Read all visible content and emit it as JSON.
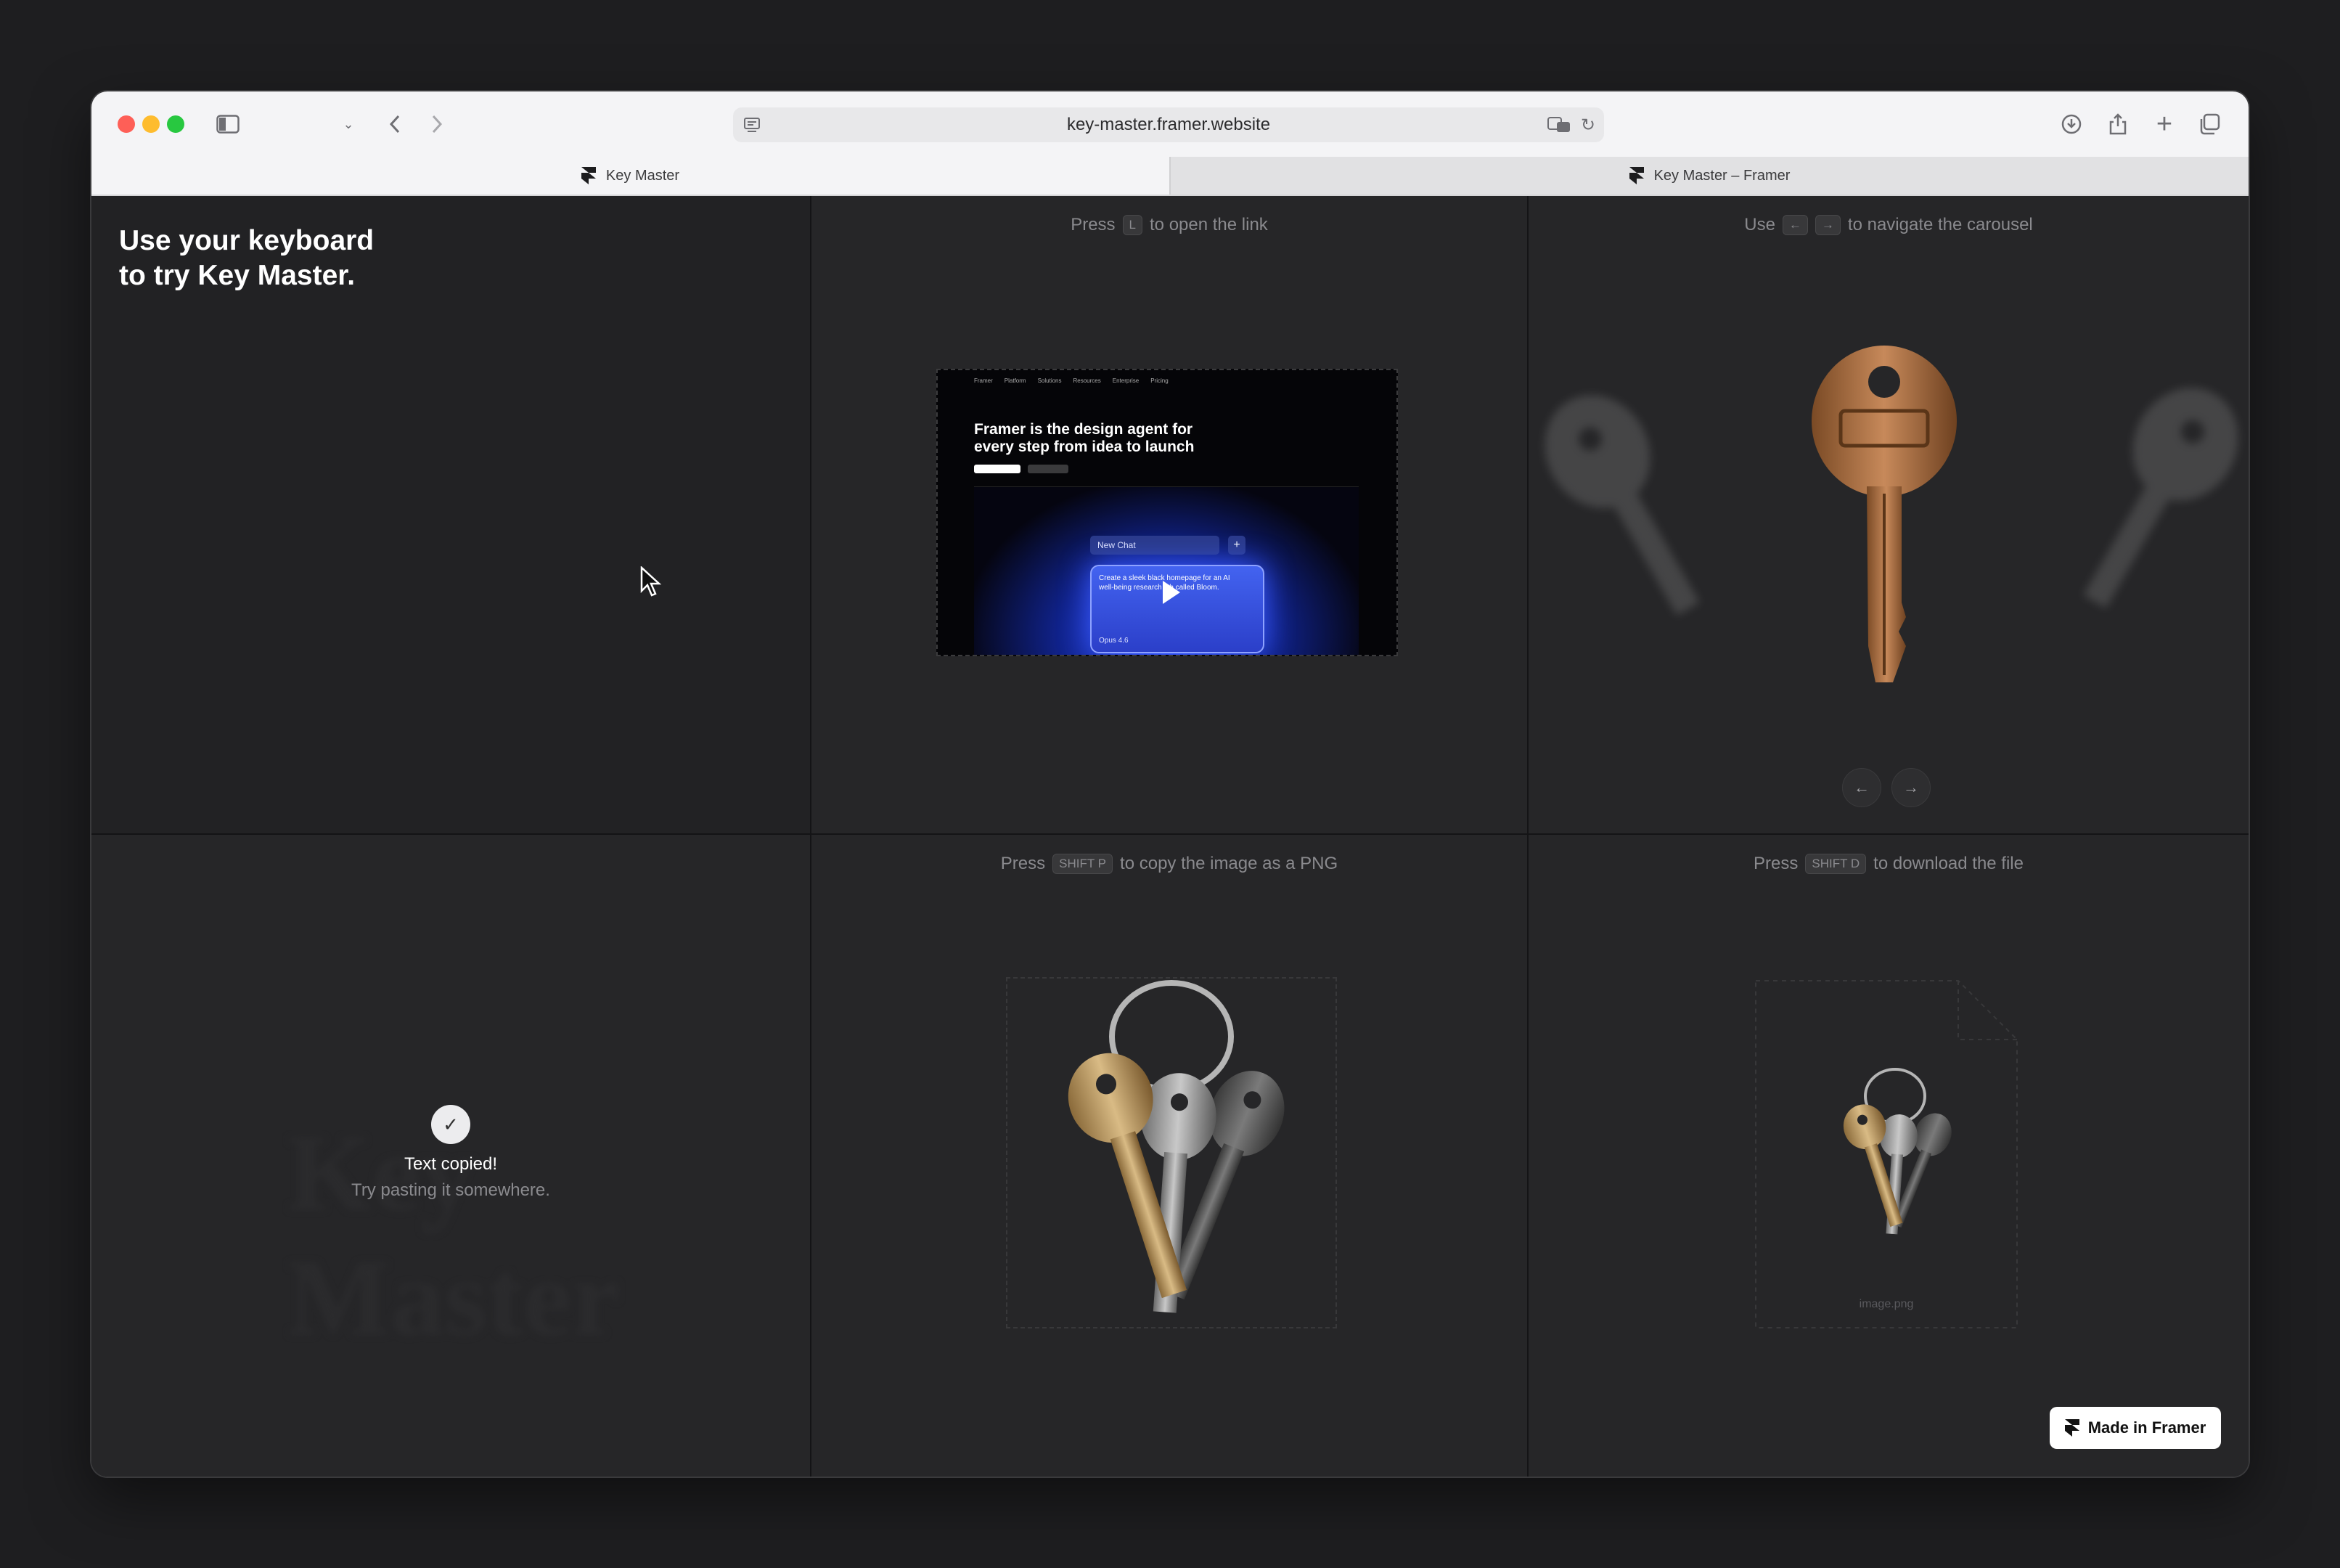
{
  "browser": {
    "url": "key-master.framer.website",
    "tabs": [
      {
        "label": "Key Master",
        "active": true
      },
      {
        "label": "Key Master – Framer",
        "active": false
      }
    ]
  },
  "intro": {
    "line1": "Use your keyboard",
    "line2": "to try Key Master."
  },
  "link_panel": {
    "hint_before": "Press",
    "key": "L",
    "hint_after": "to open the link",
    "preview": {
      "title_line1": "Framer is the design agent for",
      "title_line2": "every step from idea to launch",
      "nav_items": [
        "Framer",
        "Platform",
        "Solutions",
        "Resources",
        "Enterprise",
        "Pricing"
      ],
      "chat_label": "New Chat",
      "prompt": "Create a sleek black homepage for an AI well-being research lab called Bloom.",
      "model": "Opus 4.6"
    }
  },
  "carousel_panel": {
    "hint_before": "Use",
    "key_left": "←",
    "key_right": "→",
    "hint_after": "to navigate the carousel",
    "prev_label": "←",
    "next_label": "→"
  },
  "copy_text_panel": {
    "ghost_text": "Key Master",
    "toast_icon": "✓",
    "toast_title": "Text copied!",
    "toast_sub": "Try pasting it somewhere."
  },
  "png_panel": {
    "hint_before": "Press",
    "key": "SHIFT P",
    "hint_after": "to copy the image as a PNG"
  },
  "download_panel": {
    "hint_before": "Press",
    "key": "SHIFT D",
    "hint_after": "to download the file",
    "filename": "image.png"
  },
  "badge": {
    "label": "Made in Framer"
  },
  "colors": {
    "background": "#1e1e20",
    "panel": "#262628",
    "accent_blue": "#2a4cff",
    "key_brass": "#b5793f"
  }
}
